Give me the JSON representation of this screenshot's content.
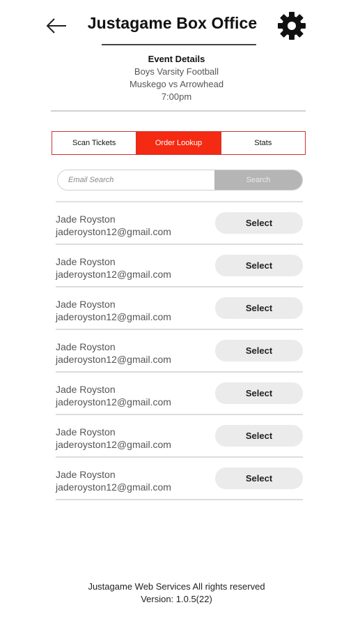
{
  "header": {
    "title": "Justagame Box Office",
    "back_icon": "arrow-left-icon",
    "settings_icon": "gear-icon"
  },
  "event": {
    "heading": "Event Details",
    "name": "Boys Varsity Football",
    "matchup": "Muskego vs Arrowhead",
    "time": "7:00pm"
  },
  "tabs": [
    {
      "label": "Scan Tickets",
      "active": false
    },
    {
      "label": "Order Lookup",
      "active": true
    },
    {
      "label": "Stats",
      "active": false
    }
  ],
  "search": {
    "placeholder": "Email Search",
    "value": "",
    "button_label": "Search"
  },
  "orders": [
    {
      "name": "Jade Royston",
      "email": "jaderoyston12@gmail.com",
      "action": "Select"
    },
    {
      "name": "Jade Royston",
      "email": "jaderoyston12@gmail.com",
      "action": "Select"
    },
    {
      "name": "Jade Royston",
      "email": "jaderoyston12@gmail.com",
      "action": "Select"
    },
    {
      "name": "Jade Royston",
      "email": "jaderoyston12@gmail.com",
      "action": "Select"
    },
    {
      "name": "Jade Royston",
      "email": "jaderoyston12@gmail.com",
      "action": "Select"
    },
    {
      "name": "Jade Royston",
      "email": "jaderoyston12@gmail.com",
      "action": "Select"
    },
    {
      "name": "Jade Royston",
      "email": "jaderoyston12@gmail.com",
      "action": "Select"
    }
  ],
  "footer": {
    "copyright": "Justagame Web Services All rights reserved",
    "version": "Version: 1.0.5(22)"
  },
  "colors": {
    "accent": "#f52a12",
    "tab_border": "#cc3333",
    "search_button": "#b5b5b5",
    "select_button": "#ebebeb"
  }
}
